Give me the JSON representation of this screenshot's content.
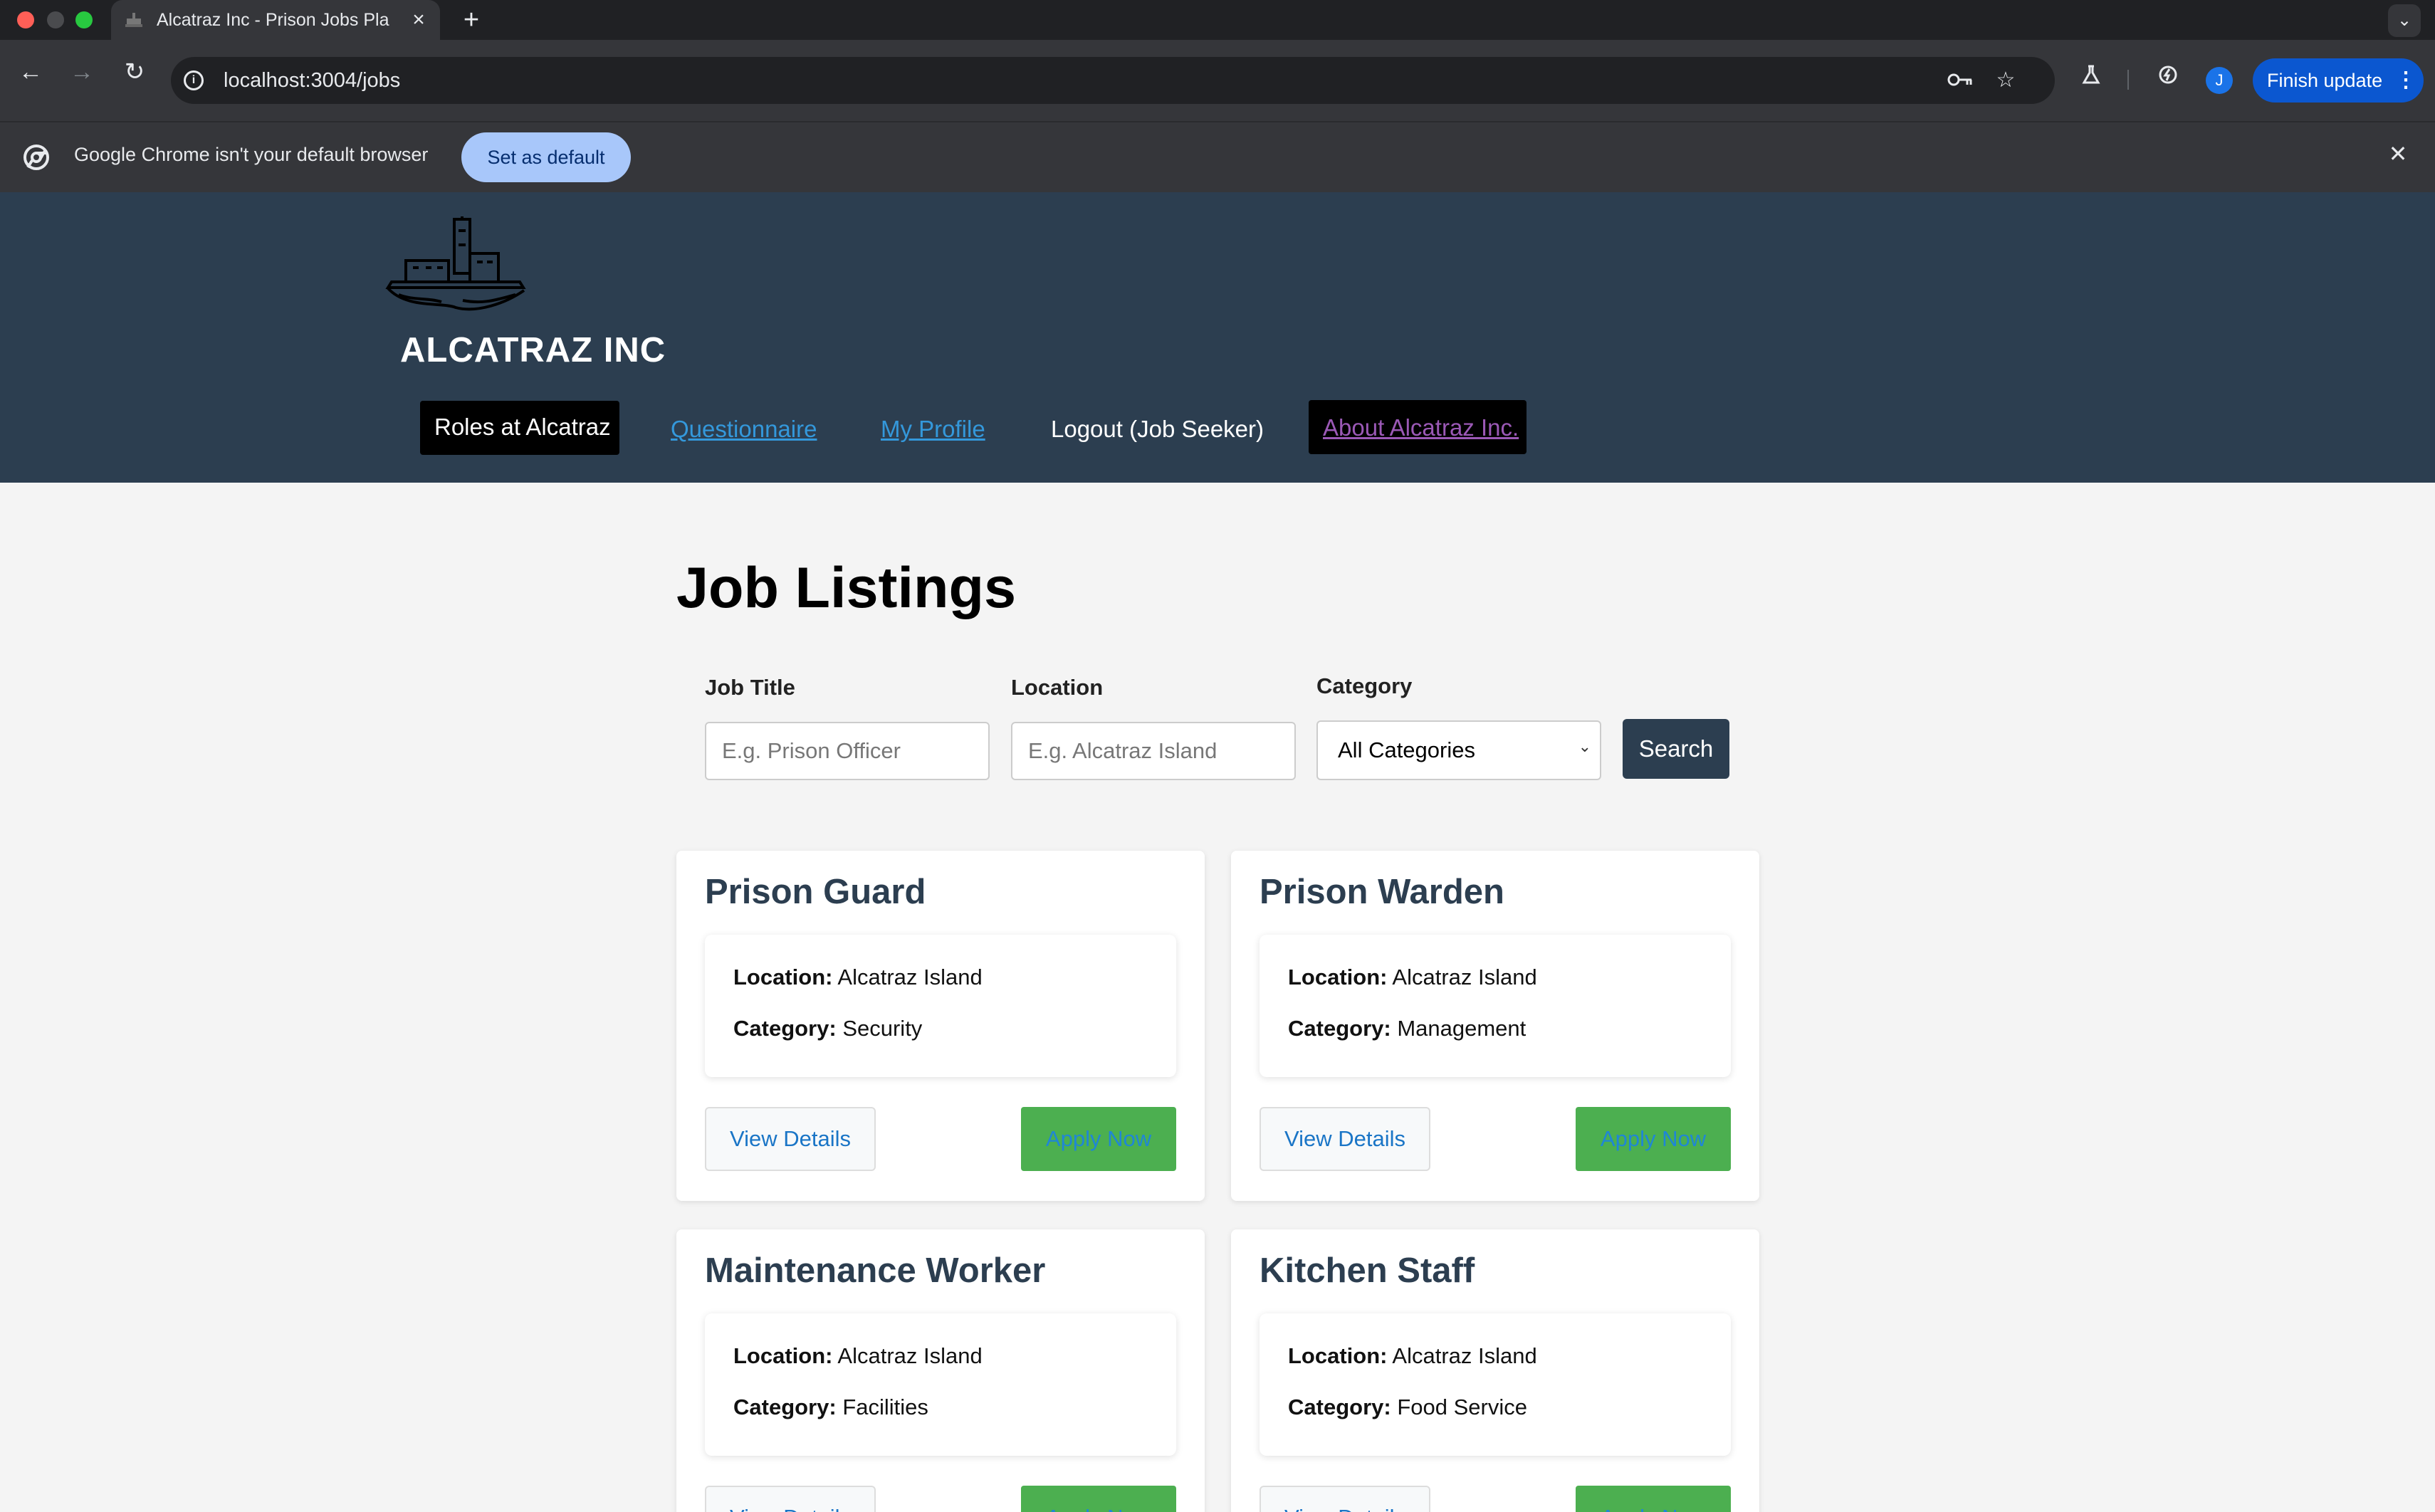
{
  "browser": {
    "tab_title": "Alcatraz Inc - Prison Jobs Pla",
    "url": "localhost:3004/jobs",
    "profile_initial": "J",
    "finish_update_label": "Finish update",
    "infobar_message": "Google Chrome isn't your default browser",
    "set_default_label": "Set as default"
  },
  "header": {
    "brand": "ALCATRAZ INC",
    "nav": {
      "roles": "Roles at Alcatraz",
      "questionnaire": "Questionnaire",
      "profile": "My Profile",
      "logout": "Logout (Job Seeker)",
      "about": "About Alcatraz Inc."
    }
  },
  "main": {
    "title": "Job Listings",
    "filters": {
      "job_title_label": "Job Title",
      "job_title_placeholder": "E.g. Prison Officer",
      "location_label": "Location",
      "location_placeholder": "E.g. Alcatraz Island",
      "category_label": "Category",
      "category_selected": "All Categories",
      "search_label": "Search"
    },
    "field_labels": {
      "location": "Location:",
      "category": "Category:"
    },
    "button_labels": {
      "view": "View Details",
      "apply": "Apply Now"
    },
    "jobs": [
      {
        "title": "Prison Guard",
        "location": "Alcatraz Island",
        "category": "Security"
      },
      {
        "title": "Prison Warden",
        "location": "Alcatraz Island",
        "category": "Management"
      },
      {
        "title": "Maintenance Worker",
        "location": "Alcatraz Island",
        "category": "Facilities"
      },
      {
        "title": "Kitchen Staff",
        "location": "Alcatraz Island",
        "category": "Food Service"
      }
    ]
  },
  "colors": {
    "header_bg": "#2c3e50",
    "link": "#3498db",
    "visited_link": "#9b59b6",
    "apply_bg": "#4caf50"
  }
}
